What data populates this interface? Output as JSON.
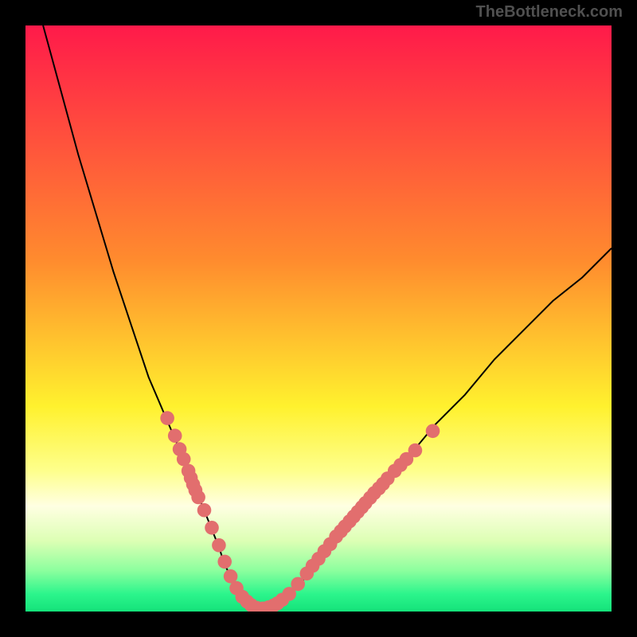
{
  "watermark": "TheBottleneck.com",
  "chart_data": {
    "type": "line",
    "title": "",
    "xlabel": "",
    "ylabel": "",
    "xlim": [
      0,
      100
    ],
    "ylim": [
      0,
      100
    ],
    "background_gradient": {
      "stops": [
        {
          "offset": 0,
          "color": "#ff1a4a"
        },
        {
          "offset": 40,
          "color": "#ff8b2e"
        },
        {
          "offset": 65,
          "color": "#fff12e"
        },
        {
          "offset": 76,
          "color": "#feff8c"
        },
        {
          "offset": 82,
          "color": "#ffffe2"
        },
        {
          "offset": 88,
          "color": "#dcffb4"
        },
        {
          "offset": 93,
          "color": "#8cff9e"
        },
        {
          "offset": 97,
          "color": "#2cf58c"
        },
        {
          "offset": 100,
          "color": "#14e27a"
        }
      ]
    },
    "series": [
      {
        "name": "bottleneck-curve",
        "color": "#000000",
        "x": [
          3,
          6,
          9,
          12,
          15,
          18,
          21,
          24,
          27,
          29,
          31,
          33,
          34,
          36,
          40,
          45,
          50,
          55,
          60,
          65,
          70,
          75,
          80,
          85,
          90,
          95,
          100
        ],
        "y": [
          100,
          89,
          78,
          68,
          58,
          49,
          40,
          33,
          26,
          21,
          16,
          11,
          8,
          4,
          0.5,
          3,
          8,
          14,
          20,
          26,
          32,
          37,
          43,
          48,
          53,
          57,
          62
        ]
      }
    ],
    "markers": {
      "color": "#e26e6e",
      "radius": 1.2,
      "points": [
        {
          "x": 24.2,
          "y": 33
        },
        {
          "x": 25.5,
          "y": 30
        },
        {
          "x": 26.3,
          "y": 27.7
        },
        {
          "x": 27.0,
          "y": 26
        },
        {
          "x": 27.8,
          "y": 24
        },
        {
          "x": 28.2,
          "y": 22.8
        },
        {
          "x": 28.6,
          "y": 21.7
        },
        {
          "x": 29.0,
          "y": 20.7
        },
        {
          "x": 29.5,
          "y": 19.5
        },
        {
          "x": 30.5,
          "y": 17.3
        },
        {
          "x": 31.8,
          "y": 14.3
        },
        {
          "x": 33.0,
          "y": 11.3
        },
        {
          "x": 34.0,
          "y": 8.5
        },
        {
          "x": 35.0,
          "y": 6
        },
        {
          "x": 36.0,
          "y": 4
        },
        {
          "x": 37.0,
          "y": 2.5
        },
        {
          "x": 37.8,
          "y": 1.7
        },
        {
          "x": 38.5,
          "y": 1.1
        },
        {
          "x": 39.5,
          "y": 0.6
        },
        {
          "x": 40.5,
          "y": 0.5
        },
        {
          "x": 41.5,
          "y": 0.7
        },
        {
          "x": 42.3,
          "y": 1.0
        },
        {
          "x": 43.0,
          "y": 1.4
        },
        {
          "x": 43.8,
          "y": 2.0
        },
        {
          "x": 45.0,
          "y": 3.0
        },
        {
          "x": 46.5,
          "y": 4.7
        },
        {
          "x": 48.0,
          "y": 6.5
        },
        {
          "x": 49.0,
          "y": 7.8
        },
        {
          "x": 50.0,
          "y": 9.0
        },
        {
          "x": 51.0,
          "y": 10.3
        },
        {
          "x": 52.0,
          "y": 11.5
        },
        {
          "x": 53.0,
          "y": 12.8
        },
        {
          "x": 53.8,
          "y": 13.7
        },
        {
          "x": 54.5,
          "y": 14.5
        },
        {
          "x": 55.3,
          "y": 15.4
        },
        {
          "x": 56.0,
          "y": 16.2
        },
        {
          "x": 56.7,
          "y": 17.0
        },
        {
          "x": 57.4,
          "y": 17.8
        },
        {
          "x": 58.0,
          "y": 18.5
        },
        {
          "x": 58.8,
          "y": 19.4
        },
        {
          "x": 59.5,
          "y": 20.2
        },
        {
          "x": 60.3,
          "y": 21.0
        },
        {
          "x": 61.0,
          "y": 21.8
        },
        {
          "x": 61.8,
          "y": 22.7
        },
        {
          "x": 63.0,
          "y": 24.0
        },
        {
          "x": 64.0,
          "y": 25.0
        },
        {
          "x": 65.0,
          "y": 26.0
        },
        {
          "x": 66.5,
          "y": 27.5
        },
        {
          "x": 69.5,
          "y": 30.8
        }
      ]
    }
  }
}
